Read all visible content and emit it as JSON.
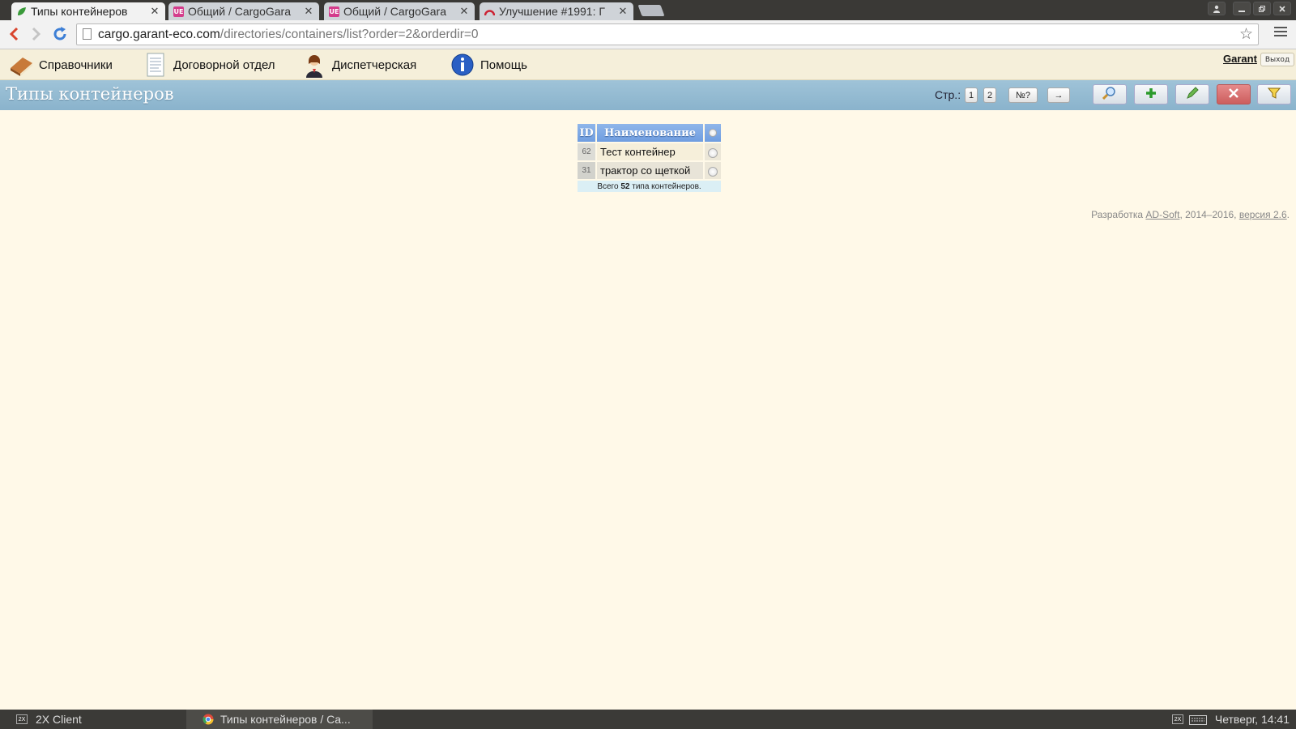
{
  "browser": {
    "tabs": [
      {
        "title": "Типы контейнеров",
        "active": true
      },
      {
        "title": "Общий / CargoGara",
        "active": false
      },
      {
        "title": "Общий / CargoGara",
        "active": false
      },
      {
        "title": "Улучшение #1991: Г",
        "active": false
      }
    ],
    "favicon_labels": {
      "ue": "UE"
    },
    "close_glyph": "✕",
    "url_host": "cargo.garant-eco.com",
    "url_path": "/directories/containers/list?order=2&orderdir=0"
  },
  "nav": {
    "items": [
      {
        "label": "Справочники",
        "icon": "book-icon"
      },
      {
        "label": "Договорной отдел",
        "icon": "document-icon"
      },
      {
        "label": "Диспетчерская",
        "icon": "dispatcher-icon"
      },
      {
        "label": "Помощь",
        "icon": "info-icon"
      }
    ],
    "user": "Garant",
    "logout": "Выход"
  },
  "page": {
    "title": "Типы контейнеров",
    "pager_label": "Стр.:",
    "pages": [
      "1",
      "2"
    ],
    "goto_page": "№?",
    "next": "→"
  },
  "table": {
    "headers": {
      "id": "ID",
      "name": "Наименование"
    },
    "rows": [
      {
        "id": "62",
        "name": "Тест контейнер"
      },
      {
        "id": "31",
        "name": "трактор со щеткой"
      }
    ],
    "footer": {
      "prefix": "Всего",
      "count": "52",
      "suffix": "типа контейнеров."
    }
  },
  "credits": {
    "prefix": "Разработка",
    "company": "AD-Soft",
    "years": ", 2014–2016, ",
    "version": "версия 2.6",
    "end": "."
  },
  "taskbar": {
    "items": [
      {
        "label": "2X Client"
      },
      {
        "label": "Типы контейнеров / Ca..."
      }
    ],
    "tray_label": "2X",
    "clock": "Четверг, 14:41"
  }
}
